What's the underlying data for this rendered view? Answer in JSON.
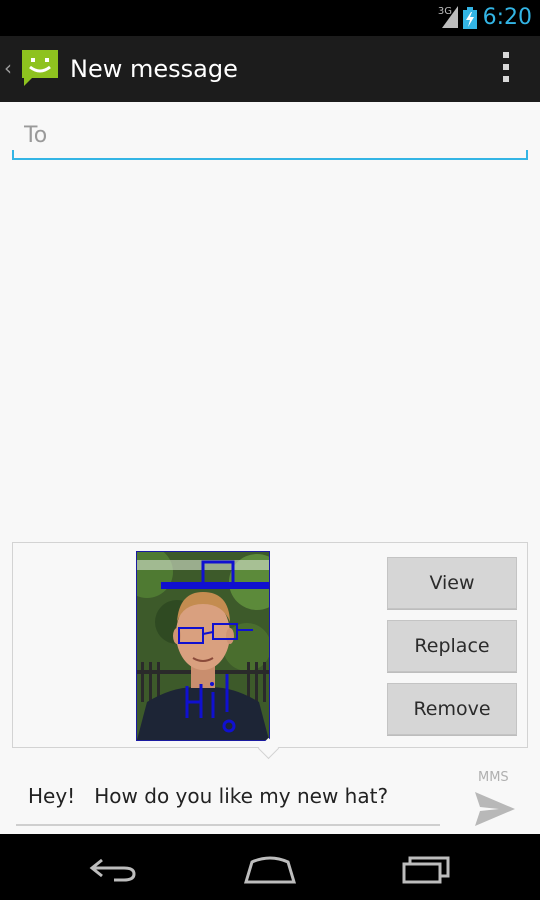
{
  "status_bar": {
    "network": "3G",
    "time": "6:20",
    "icons": [
      "signal-icon",
      "battery-charging-icon"
    ]
  },
  "action_bar": {
    "title": "New message",
    "icons": [
      "up-caret-icon",
      "messaging-app-icon",
      "overflow-menu-icon"
    ]
  },
  "to_field": {
    "placeholder": "To",
    "value": ""
  },
  "attachment": {
    "image_icon": "photo-thumbnail",
    "buttons": {
      "view": "View",
      "replace": "Replace",
      "remove": "Remove"
    }
  },
  "compose": {
    "message": "Hey!   How do you like my new hat?",
    "type_label": "MMS",
    "send_icon": "send-icon"
  },
  "nav_bar": {
    "icons": [
      "back-icon",
      "home-icon",
      "recents-icon"
    ]
  },
  "colors": {
    "accent": "#33b5e5",
    "action_bar": "#1c1c1c",
    "background": "#f8f8f8",
    "sketch_blue": "#1010d0"
  }
}
